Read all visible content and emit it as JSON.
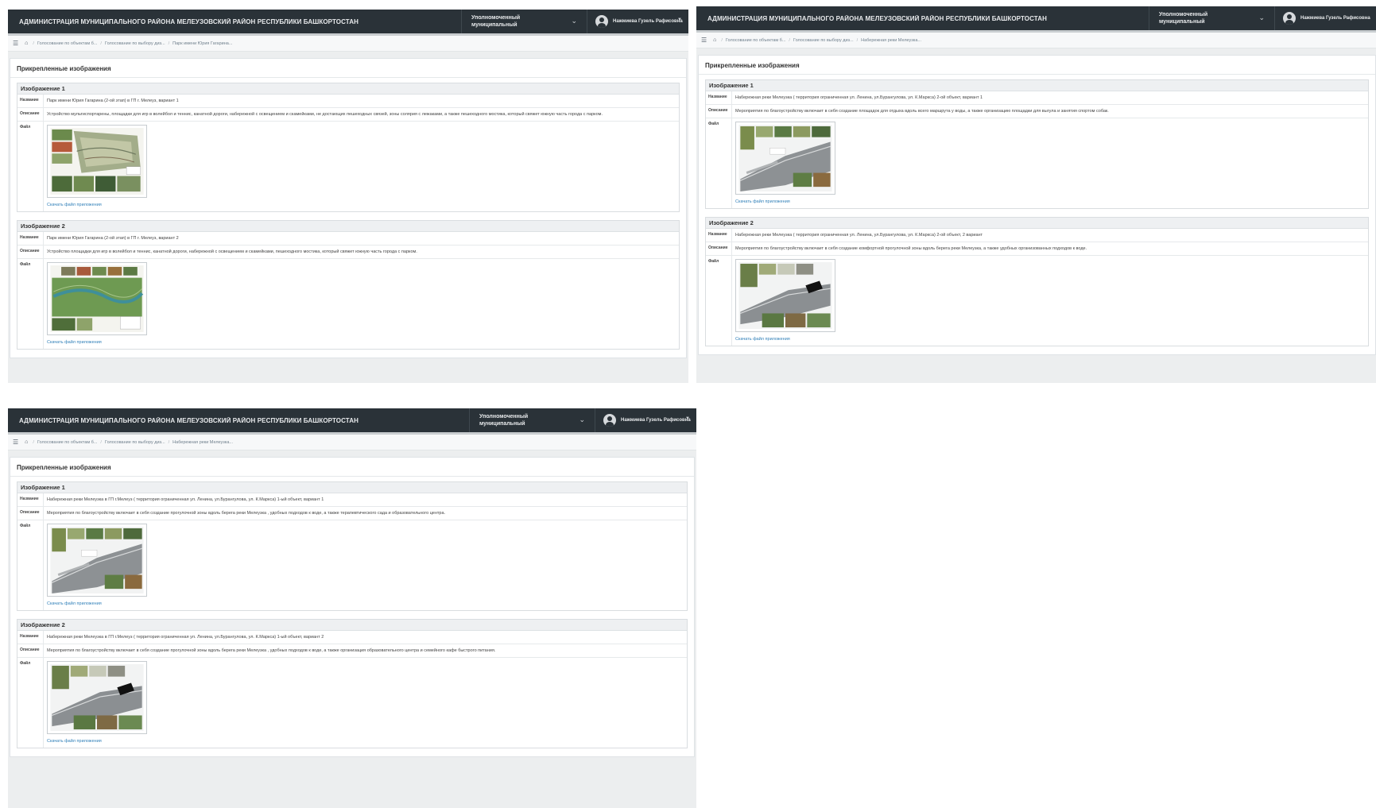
{
  "header": {
    "org_title": "АДМИНИСТРАЦИЯ МУНИЦИПАЛЬНОГО РАЙОНА МЕЛЕУЗОВСКИЙ РАЙОН РЕСПУБЛИКИ БАШКОРТОСТАН",
    "role_label": "Уполномоченный муниципальный",
    "user_name": "Нажмиева Гузель Рафисовна"
  },
  "labels": {
    "section_title": "Прикрепленные изображения",
    "name": "Название",
    "description": "Описание",
    "file": "Файл",
    "download": "Скачать файл приложения"
  },
  "colors": {
    "topbar": "#2a3238",
    "link": "#2f7fb8",
    "panel_bg": "#eceeef"
  },
  "panels": [
    {
      "breadcrumbs": [
        "Голосование по объектам б...",
        "Голосование по выбору диз...",
        "Парк имени Юрия Гагарина..."
      ],
      "images": [
        {
          "heading": "Изображение 1",
          "name": "Парк имени Юрия Гагарина (2-ой этап) в ГП г. Мелеуз, вариант 1",
          "description": "Устройство мультиспортарены, площадки для игр в волейбол и теннис, канатной дороги, набережной с освещением и скамейками, не достающих пешеходных связей, зоны солярия с лежаками, а также пешеходного мостика, который свяжет южную часть города с парком."
        },
        {
          "heading": "Изображение 2",
          "name": "Парк имени Юрия Гагарина (2-ой этап) в ГП г. Мелеуз, вариант 2",
          "description": "Устройство площадки для игр в волейбол и теннис, канатной дороги, набережной с освещением и скамейками, пешеходного мостика, который свяжет южную часть города с парком."
        }
      ]
    },
    {
      "breadcrumbs": [
        "Голосование по объектам б...",
        "Голосование по выбору диз...",
        "Набережная реки Мелеузка..."
      ],
      "images": [
        {
          "heading": "Изображение 1",
          "name": "Набережная реки Мелеузка ( территория ограниченная ул. Ленина, ул.Бурангулова, ул. К.Маркса) 2-ой объект, вариант 1",
          "description": "Мероприятия по благоустройству включает в себя создание площадок для отдыха вдоль всего маршрута у воды, а также организацию площадки для выгула и занятия спортом собак."
        },
        {
          "heading": "Изображение 2",
          "name": "Набережная реки Мелеузка ( территория ограниченная ул. Ленина, ул.Бурангулова, ул. К.Маркса) 2-ой объект, 2 вариант",
          "description": "Мероприятия по благоустройству включает в себя создание комфортной прогулочной зоны вдоль берега реки Мелеузка, а также удобных организованных подходов к воде."
        }
      ]
    },
    {
      "breadcrumbs": [
        "Голосование по объектам б...",
        "Голосование по выбору диз...",
        "Набережная реки Мелеузка..."
      ],
      "images": [
        {
          "heading": "Изображение 1",
          "name": "Набережная реки Мелеузка в ГП г.Мелеуз ( территория ограниченная ул. Ленина, ул.Бурангулова, ул. К.Маркса) 1-ый объект, вариант 1",
          "description": "Мероприятия по благоустройству включает в себя создание прогулочной зоны вдоль берега реки Мелеузка , удобных подходов к воде, а также терапевтического сада и образовательного центра."
        },
        {
          "heading": "Изображение 2",
          "name": "Набережная реки Мелеузка в ГП г.Мелеуз ( территория ограниченная ул. Ленина, ул.Бурангулова, ул. К.Маркса) 1-ый объект, вариант 2",
          "description": "Мероприятия по благоустройству включает в себя создание прогулочной зоны вдоль берега реки Мелеузка , удобных подходов к воде, а также организация образовательного центра и семейного кафе быстрого питания."
        }
      ]
    }
  ]
}
